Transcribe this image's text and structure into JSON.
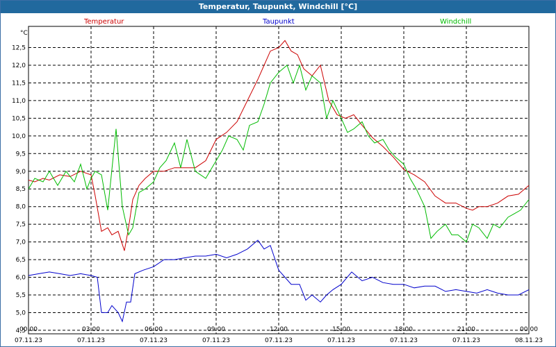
{
  "window": {
    "title": "Temperatur, Taupunkt, Windchill [°C]"
  },
  "colors": {
    "titlebar": "#21699e",
    "temperatur": "#cc0000",
    "taupunkt": "#0000cc",
    "windchill": "#00bb00",
    "grid": "#000000"
  },
  "chart_data": {
    "type": "line",
    "title": "Temperatur, Taupunkt, Windchill [°C]",
    "ylabel": "°C",
    "ylim": [
      4.4,
      13.1
    ],
    "xlim": [
      0,
      24
    ],
    "grid": true,
    "legend_placement": "top",
    "yticks": [
      "4,5",
      "5,0",
      "5,5",
      "6,0",
      "6,5",
      "7,0",
      "7,5",
      "8,0",
      "8,5",
      "9,0",
      "9,5",
      "10,0",
      "10,5",
      "11,0",
      "11,5",
      "12,0",
      "12,5"
    ],
    "ytick_values": [
      4.5,
      5.0,
      5.5,
      6.0,
      6.5,
      7.0,
      7.5,
      8.0,
      8.5,
      9.0,
      9.5,
      10.0,
      10.5,
      11.0,
      11.5,
      12.0,
      12.5
    ],
    "xticks": [
      {
        "time": "00:00",
        "date": "07.11.23",
        "hour": 0
      },
      {
        "time": "03:00",
        "date": "07.11.23",
        "hour": 3
      },
      {
        "time": "06:00",
        "date": "07.11.23",
        "hour": 6
      },
      {
        "time": "09:00",
        "date": "07.11.23",
        "hour": 9
      },
      {
        "time": "12:00",
        "date": "07.11.23",
        "hour": 12
      },
      {
        "time": "15:00",
        "date": "07.11.23",
        "hour": 15
      },
      {
        "time": "18:00",
        "date": "07.11.23",
        "hour": 18
      },
      {
        "time": "21:00",
        "date": "07.11.23",
        "hour": 21
      },
      {
        "time": "00:00",
        "date": "08.11.23",
        "hour": 24
      }
    ],
    "series": [
      {
        "name": "Temperatur",
        "color": "#cc0000",
        "x": [
          0,
          0.3,
          0.7,
          1.0,
          1.5,
          2.0,
          2.5,
          3.0,
          3.2,
          3.5,
          3.8,
          4.0,
          4.3,
          4.6,
          4.8,
          5.0,
          5.3,
          5.6,
          6.0,
          6.5,
          7.0,
          7.5,
          8.0,
          8.5,
          9.0,
          9.5,
          10.0,
          10.5,
          11.0,
          11.3,
          11.6,
          12.0,
          12.3,
          12.6,
          12.9,
          13.2,
          13.6,
          14.0,
          14.4,
          14.8,
          15.2,
          15.6,
          16.0,
          16.5,
          17.0,
          17.5,
          18.0,
          18.5,
          19.0,
          19.5,
          20.0,
          20.5,
          21.0,
          21.3,
          21.6,
          22.0,
          22.5,
          23.0,
          23.5,
          24.0
        ],
        "y": [
          8.75,
          8.7,
          8.8,
          8.75,
          8.9,
          8.85,
          9.0,
          8.9,
          8.3,
          7.3,
          7.4,
          7.2,
          7.3,
          6.75,
          7.4,
          8.2,
          8.6,
          8.8,
          9.0,
          9.0,
          9.1,
          9.1,
          9.1,
          9.3,
          9.9,
          10.1,
          10.4,
          11.0,
          11.6,
          12.0,
          12.4,
          12.5,
          12.7,
          12.4,
          12.3,
          11.9,
          11.7,
          12.0,
          11.0,
          10.6,
          10.5,
          10.6,
          10.3,
          9.95,
          9.7,
          9.4,
          9.05,
          8.9,
          8.7,
          8.3,
          8.1,
          8.1,
          7.95,
          7.9,
          8.0,
          8.0,
          8.1,
          8.3,
          8.35,
          8.6
        ]
      },
      {
        "name": "Taupunkt",
        "color": "#0000cc",
        "x": [
          0,
          0.5,
          1.0,
          1.5,
          2.0,
          2.5,
          3.0,
          3.3,
          3.5,
          3.8,
          4.0,
          4.3,
          4.5,
          4.7,
          4.9,
          5.1,
          5.5,
          6.0,
          6.5,
          7.0,
          7.5,
          8.0,
          8.5,
          9.0,
          9.5,
          10.0,
          10.5,
          11.0,
          11.3,
          11.6,
          12.0,
          12.3,
          12.6,
          13.0,
          13.3,
          13.6,
          14.0,
          14.3,
          14.6,
          15.0,
          15.5,
          16.0,
          16.5,
          17.0,
          17.5,
          18.0,
          18.5,
          19.0,
          19.5,
          20.0,
          20.5,
          21.0,
          21.5,
          22.0,
          22.5,
          23.0,
          23.5,
          24.0
        ],
        "y": [
          6.05,
          6.1,
          6.15,
          6.1,
          6.05,
          6.1,
          6.05,
          6.0,
          5.0,
          5.0,
          5.2,
          5.0,
          4.75,
          5.3,
          5.3,
          6.1,
          6.2,
          6.3,
          6.5,
          6.5,
          6.55,
          6.6,
          6.6,
          6.65,
          6.55,
          6.65,
          6.8,
          7.05,
          6.8,
          6.9,
          6.2,
          6.0,
          5.8,
          5.8,
          5.35,
          5.5,
          5.3,
          5.5,
          5.65,
          5.8,
          6.15,
          5.9,
          6.0,
          5.85,
          5.8,
          5.8,
          5.7,
          5.75,
          5.75,
          5.6,
          5.65,
          5.6,
          5.55,
          5.65,
          5.55,
          5.5,
          5.5,
          5.65
        ]
      },
      {
        "name": "Windchill",
        "color": "#00bb00",
        "x": [
          0,
          0.3,
          0.7,
          1.0,
          1.4,
          1.8,
          2.2,
          2.5,
          2.8,
          3.0,
          3.2,
          3.5,
          3.8,
          4.2,
          4.5,
          4.8,
          5.0,
          5.3,
          5.6,
          6.0,
          6.3,
          6.6,
          7.0,
          7.3,
          7.6,
          8.0,
          8.5,
          9.0,
          9.3,
          9.6,
          10.0,
          10.3,
          10.6,
          11.0,
          11.3,
          11.6,
          12.0,
          12.2,
          12.4,
          12.7,
          13.0,
          13.3,
          13.6,
          14.0,
          14.3,
          14.6,
          15.0,
          15.3,
          15.6,
          16.0,
          16.3,
          16.6,
          17.0,
          17.3,
          17.6,
          18.0,
          18.3,
          18.6,
          19.0,
          19.3,
          19.6,
          20.0,
          20.3,
          20.6,
          21.0,
          21.3,
          21.6,
          22.0,
          22.3,
          22.6,
          23.0,
          23.3,
          23.6,
          24.0
        ],
        "y": [
          8.5,
          8.8,
          8.7,
          9.0,
          8.6,
          9.0,
          8.7,
          9.2,
          8.5,
          8.8,
          9.0,
          8.9,
          7.9,
          10.2,
          8.0,
          7.2,
          7.4,
          8.4,
          8.5,
          8.7,
          9.1,
          9.3,
          9.8,
          9.1,
          9.9,
          9.0,
          8.8,
          9.3,
          9.6,
          10.0,
          9.9,
          9.6,
          10.3,
          10.4,
          10.9,
          11.5,
          11.8,
          11.9,
          12.0,
          11.5,
          12.0,
          11.3,
          11.7,
          11.5,
          10.5,
          11.0,
          10.5,
          10.1,
          10.2,
          10.4,
          10.0,
          9.8,
          9.9,
          9.6,
          9.4,
          9.2,
          8.8,
          8.5,
          8.0,
          7.1,
          7.3,
          7.5,
          7.2,
          7.2,
          7.0,
          7.5,
          7.4,
          7.1,
          7.5,
          7.4,
          7.7,
          7.8,
          7.9,
          8.2
        ]
      }
    ]
  }
}
